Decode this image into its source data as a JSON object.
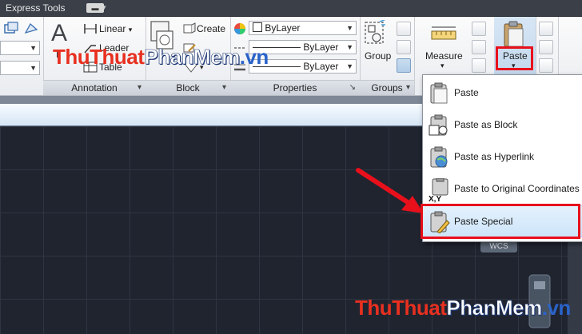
{
  "tabstrip": {
    "tab_label": "Express Tools"
  },
  "annotation": {
    "title": "Annotation",
    "text_label": "T",
    "linear_label": "Linear",
    "leader_label": "Leader",
    "table_label": "Table"
  },
  "block": {
    "title": "Block",
    "create_label": "Create"
  },
  "properties": {
    "title": "Properties",
    "color_value": "ByLayer",
    "linetype_value": "ByLayer",
    "lineweight_value": "ByLayer",
    "launcher": "↘"
  },
  "groups": {
    "title": "Groups",
    "group_label": "Group"
  },
  "utilities": {
    "measure_label": "Measure"
  },
  "clipboard": {
    "paste_label": "Paste"
  },
  "paste_menu": {
    "items": [
      {
        "label": "Paste",
        "icon": "clipboard-icon"
      },
      {
        "label": "Paste as Block",
        "icon": "clipboard-block-icon"
      },
      {
        "label": "Paste as Hyperlink",
        "icon": "clipboard-hyperlink-icon"
      },
      {
        "label": "Paste to Original Coordinates",
        "icon": "clipboard-coordinates-icon"
      },
      {
        "label": "Paste Special",
        "icon": "clipboard-special-icon"
      }
    ],
    "coords_badge": "X,Y",
    "highlighted": "Paste Special"
  },
  "viewport": {
    "wcs_label": "WCS"
  },
  "watermark": {
    "part1": "ThuThuat",
    "part2": "PhanMem",
    "part3": ".vn"
  },
  "colors": {
    "highlight_border": "#e8101b",
    "canvas_bg": "#20242f",
    "arrow": "#e8101b"
  }
}
